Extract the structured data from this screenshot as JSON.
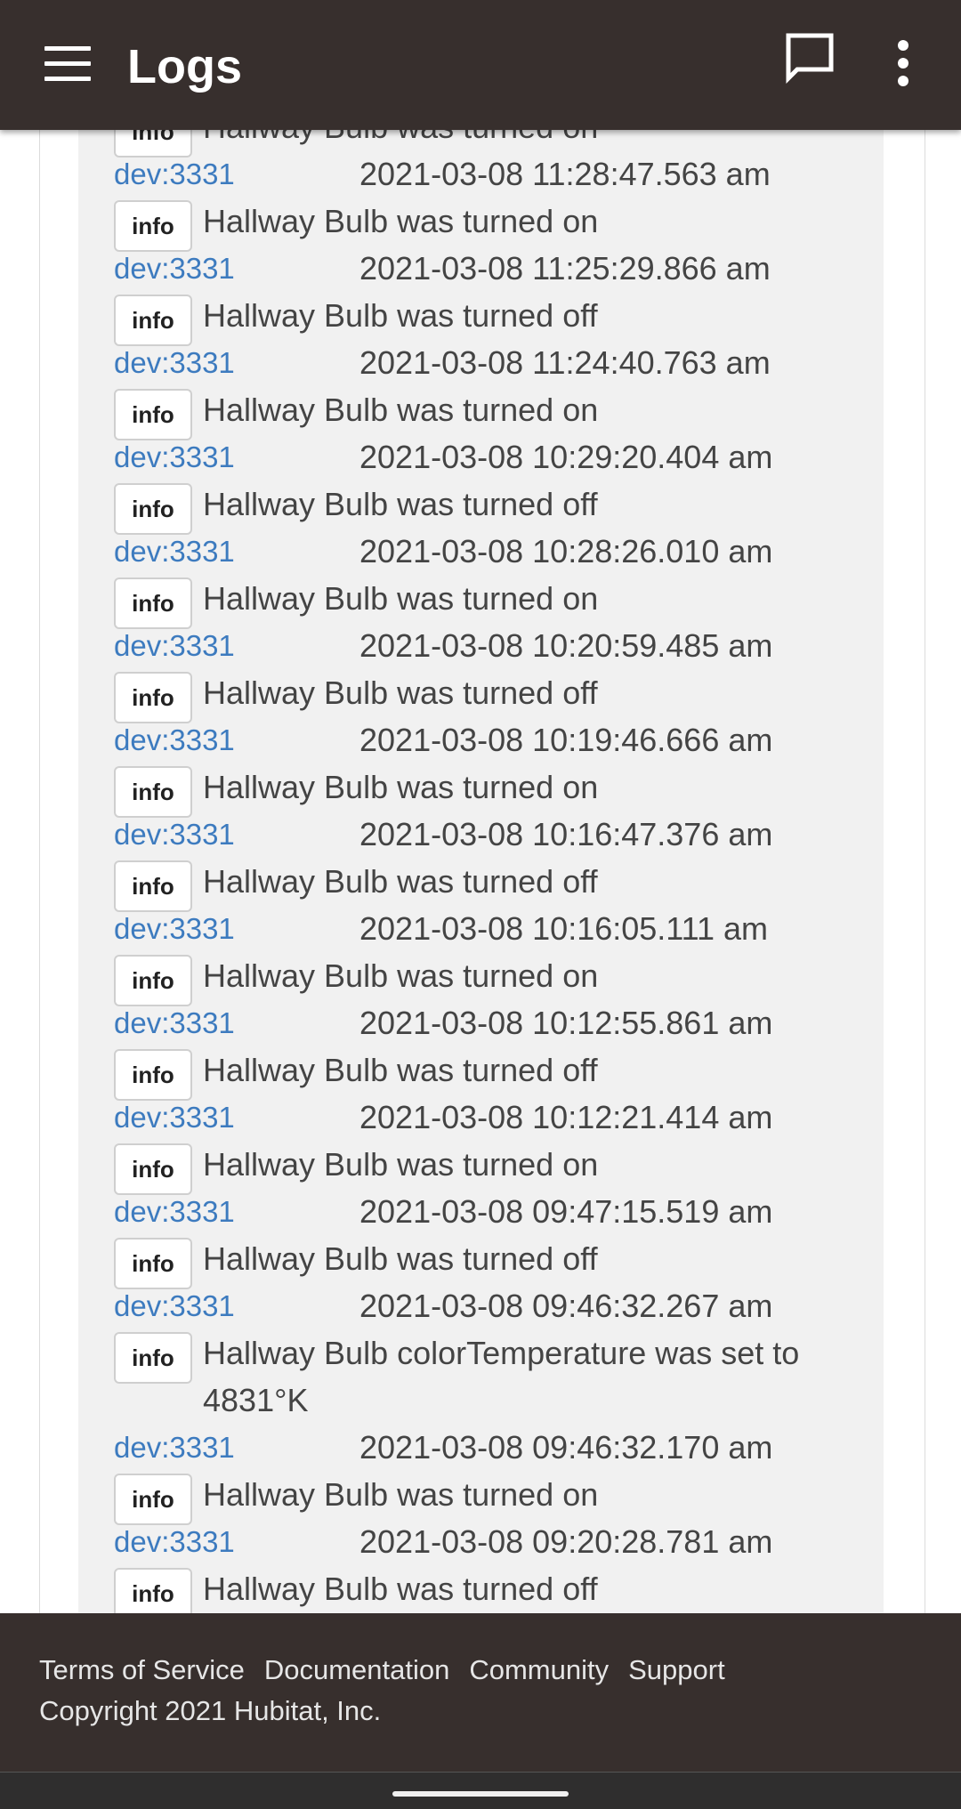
{
  "appbar": {
    "title": "Logs",
    "icons": [
      "menu-icon",
      "chat-icon",
      "more-vert-icon"
    ]
  },
  "logs": [
    {
      "level": "info",
      "message": "Hallway Bulb was turned on",
      "device": "dev:3331",
      "time": "2021-03-08 11:28:47.563 am"
    },
    {
      "level": "info",
      "message": "Hallway Bulb was turned on",
      "device": "dev:3331",
      "time": "2021-03-08 11:25:29.866 am"
    },
    {
      "level": "info",
      "message": "Hallway Bulb was turned off",
      "device": "dev:3331",
      "time": "2021-03-08 11:24:40.763 am"
    },
    {
      "level": "info",
      "message": "Hallway Bulb was turned on",
      "device": "dev:3331",
      "time": "2021-03-08 10:29:20.404 am"
    },
    {
      "level": "info",
      "message": "Hallway Bulb was turned off",
      "device": "dev:3331",
      "time": "2021-03-08 10:28:26.010 am"
    },
    {
      "level": "info",
      "message": "Hallway Bulb was turned on",
      "device": "dev:3331",
      "time": "2021-03-08 10:20:59.485 am"
    },
    {
      "level": "info",
      "message": "Hallway Bulb was turned off",
      "device": "dev:3331",
      "time": "2021-03-08 10:19:46.666 am"
    },
    {
      "level": "info",
      "message": "Hallway Bulb was turned on",
      "device": "dev:3331",
      "time": "2021-03-08 10:16:47.376 am"
    },
    {
      "level": "info",
      "message": "Hallway Bulb was turned off",
      "device": "dev:3331",
      "time": "2021-03-08 10:16:05.111 am"
    },
    {
      "level": "info",
      "message": "Hallway Bulb was turned on",
      "device": "dev:3331",
      "time": "2021-03-08 10:12:55.861 am"
    },
    {
      "level": "info",
      "message": "Hallway Bulb was turned off",
      "device": "dev:3331",
      "time": "2021-03-08 10:12:21.414 am"
    },
    {
      "level": "info",
      "message": "Hallway Bulb was turned on",
      "device": "dev:3331",
      "time": "2021-03-08 09:47:15.519 am"
    },
    {
      "level": "info",
      "message": "Hallway Bulb was turned off",
      "device": "dev:3331",
      "time": "2021-03-08 09:46:32.267 am"
    },
    {
      "level": "info",
      "message": "Hallway Bulb colorTemperature was set to 4831°K",
      "device": "dev:3331",
      "time": "2021-03-08 09:46:32.170 am"
    },
    {
      "level": "info",
      "message": "Hallway Bulb was turned on",
      "device": "dev:3331",
      "time": "2021-03-08 09:20:28.781 am"
    },
    {
      "level": "info",
      "message": "Hallway Bulb was turned off",
      "device": "",
      "time": ""
    }
  ],
  "footer": {
    "links": [
      "Terms of Service",
      "Documentation",
      "Community",
      "Support"
    ],
    "copyright": "Copyright 2021 Hubitat, Inc."
  },
  "colors": {
    "appbar_bg": "#372f2d",
    "device_link": "#3d7bbf",
    "log_panel_bg": "#f1f1f1"
  }
}
